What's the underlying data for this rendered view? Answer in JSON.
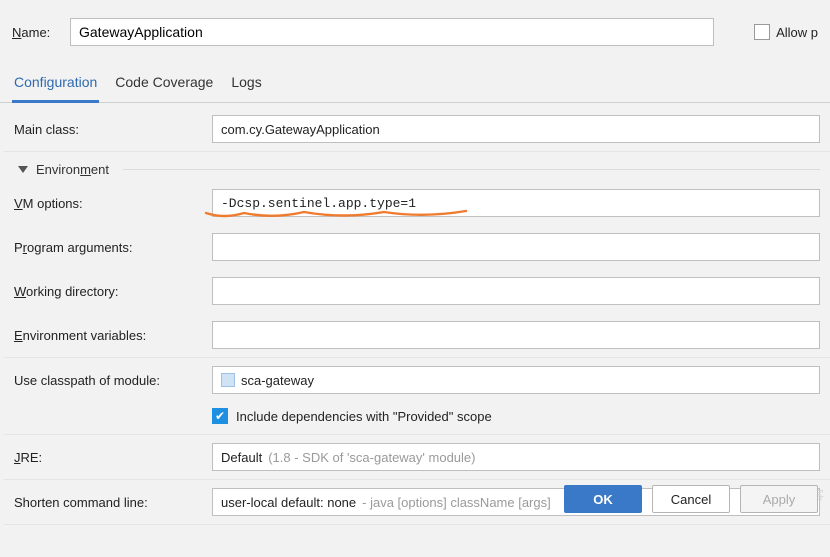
{
  "topbar": {
    "name_label": "Name:",
    "name_value": "GatewayApplication",
    "allow_label": "Allow p"
  },
  "tabs": [
    "Configuration",
    "Code Coverage",
    "Logs"
  ],
  "mainclass": {
    "label": "Main class:",
    "value": "com.cy.GatewayApplication"
  },
  "environment_section": "Environment",
  "vm": {
    "label": "VM options:",
    "value": "-Dcsp.sentinel.app.type=1"
  },
  "progargs": {
    "label": "Program arguments:",
    "value": ""
  },
  "workdir": {
    "label": "Working directory:",
    "value": ""
  },
  "envvars": {
    "label": "Environment variables:",
    "value": ""
  },
  "classpath": {
    "label": "Use classpath of module:",
    "module": "sca-gateway",
    "include_label": "Include dependencies with \"Provided\" scope"
  },
  "jre": {
    "label": "JRE:",
    "value": "Default ",
    "hint": "(1.8 - SDK of 'sca-gateway' module)"
  },
  "shorten": {
    "label": "Shorten command line:",
    "value": "user-local default: none ",
    "hint": "- java [options] className [args]"
  },
  "buttons": {
    "ok": "OK",
    "cancel": "Cancel",
    "apply": "Apply"
  },
  "watermark": "@51CTO博客"
}
